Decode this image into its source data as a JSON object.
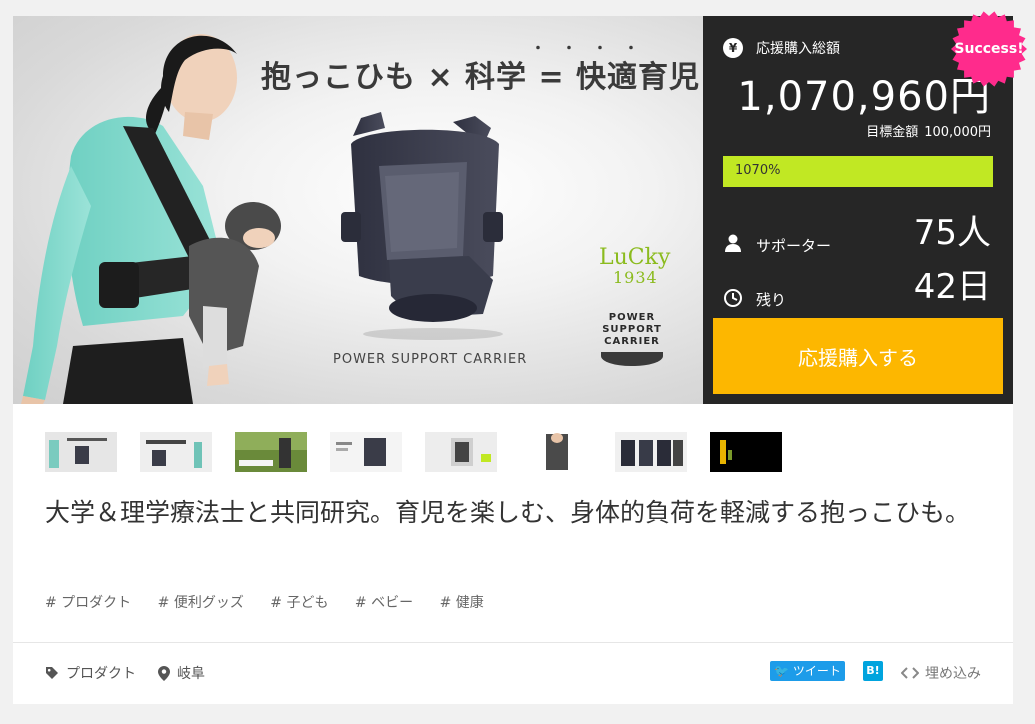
{
  "hero": {
    "title": "抱っこひも × 科学 = 快適育児",
    "title_dots": "・・・・",
    "caption": "POWER SUPPORT CARRIER",
    "brand_top": "LuCky",
    "brand_bottom": "1934",
    "psc_lines": [
      "POWER",
      "SUPPORT",
      "CARRIER"
    ]
  },
  "sidebar": {
    "total_label": "応援購入総額",
    "total_amount": "1,070,960円",
    "goal_label": "目標金額",
    "goal_amount": "100,000円",
    "progress_text": "1070%",
    "progress_fraction": 1.0,
    "supporters_label": "サポーター",
    "supporters_value": "75人",
    "remaining_label": "残り",
    "remaining_value": "42日",
    "cta_label": "応援購入する",
    "badge": "Success!",
    "colors": {
      "progress": "#c1e823",
      "cta": "#fdb700",
      "badge": "#ff2b8c",
      "panel": "#262626"
    }
  },
  "description": "大学＆理学療法士と共同研究。育児を楽しむ、身体的負荷を軽減する抱っこひも。",
  "tags": [
    "# プロダクト",
    "# 便利グッズ",
    "# 子ども",
    "# ベビー",
    "# 健康"
  ],
  "footer": {
    "category": "プロダクト",
    "location": "岐阜",
    "tweet_label": "ツイート",
    "hatena_label": "B!",
    "embed_label": "埋め込み"
  },
  "thumbnails": [
    "thumb-1",
    "thumb-2",
    "thumb-3",
    "thumb-4",
    "thumb-5",
    "thumb-6",
    "thumb-7",
    "thumb-8"
  ]
}
